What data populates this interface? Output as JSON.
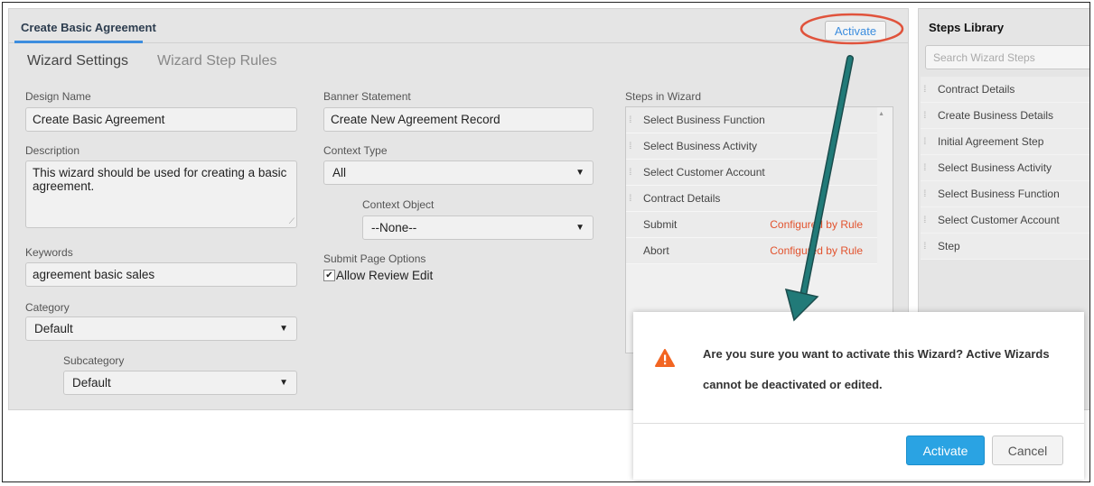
{
  "designer": {
    "title": "Create Basic Agreement",
    "activate_label": "Activate",
    "tabs": [
      {
        "label": "Wizard Settings"
      },
      {
        "label": "Wizard Step Rules"
      }
    ],
    "form": {
      "design_name": {
        "label": "Design Name",
        "value": "Create Basic Agreement"
      },
      "description": {
        "label": "Description",
        "value": "This wizard should be used for creating a basic agreement."
      },
      "keywords": {
        "label": "Keywords",
        "value": "agreement basic sales"
      },
      "category": {
        "label": "Category",
        "value": "Default"
      },
      "subcategory": {
        "label": "Subcategory",
        "value": "Default"
      },
      "banner_statement": {
        "label": "Banner Statement",
        "value": "Create New Agreement Record"
      },
      "context_type": {
        "label": "Context Type",
        "value": "All"
      },
      "context_object": {
        "label": "Context Object",
        "value": "--None--"
      },
      "submit_page_options": {
        "label": "Submit Page Options",
        "checkbox_label": "Allow Review Edit",
        "checked": true
      }
    },
    "steps_in_wizard": {
      "label": "Steps in Wizard",
      "steps": [
        {
          "label": "Select Business Function"
        },
        {
          "label": "Select Business Activity"
        },
        {
          "label": "Select Customer Account"
        },
        {
          "label": "Contract Details"
        }
      ],
      "actions": [
        {
          "label": "Submit",
          "rule": "Configured by Rule"
        },
        {
          "label": "Abort",
          "rule": "Configured by Rule"
        }
      ]
    }
  },
  "steps_library": {
    "title": "Steps Library",
    "search_placeholder": "Search Wizard Steps",
    "items": [
      {
        "label": "Contract Details"
      },
      {
        "label": "Create Business Details"
      },
      {
        "label": "Initial Agreement Step"
      },
      {
        "label": "Select Business Activity"
      },
      {
        "label": "Select Business Function"
      },
      {
        "label": "Select Customer Account"
      },
      {
        "label": "Step"
      }
    ]
  },
  "dialog": {
    "message": "Are you sure you want to activate this Wizard? Active Wizards cannot be deactivated or edited.",
    "confirm_label": "Activate",
    "cancel_label": "Cancel"
  },
  "colors": {
    "accent_blue": "#3c8dde",
    "warning_orange": "#f26522",
    "annotation_red": "#e0533c",
    "arrow_teal": "#1f6f6e",
    "rule_red": "#e2522d"
  },
  "icons": [
    "warning-icon",
    "grip-icon",
    "chevron-down-icon",
    "checkbox-icon",
    "scroll-up-icon"
  ]
}
